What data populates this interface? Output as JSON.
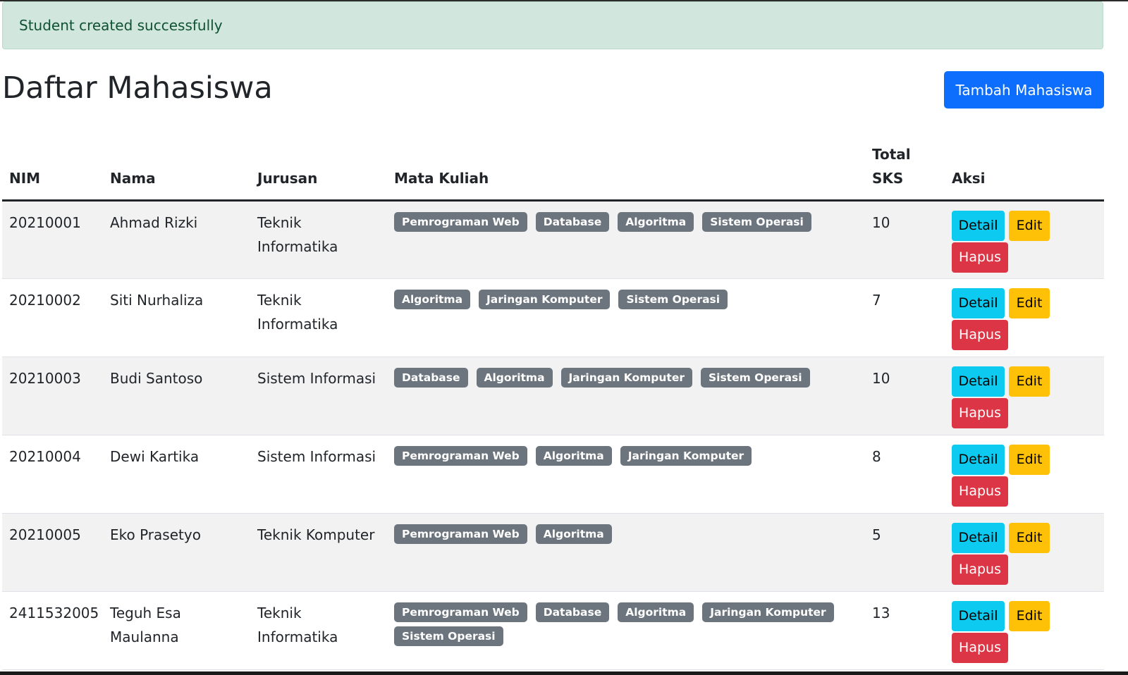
{
  "alert": {
    "message": "Student created successfully"
  },
  "header": {
    "title": "Daftar Mahasiswa",
    "add_button_label": "Tambah Mahasiswa"
  },
  "table": {
    "headers": {
      "nim": "NIM",
      "nama": "Nama",
      "jurusan": "Jurusan",
      "mata_kuliah": "Mata Kuliah",
      "total_sks_line1": "Total",
      "total_sks_line2": "SKS",
      "aksi": "Aksi"
    },
    "action_labels": {
      "detail": "Detail",
      "edit": "Edit",
      "hapus": "Hapus"
    },
    "rows": [
      {
        "nim": "20210001",
        "nama": "Ahmad Rizki",
        "jurusan": "Teknik Informatika",
        "mata_kuliah": [
          "Pemrograman Web",
          "Database",
          "Algoritma",
          "Sistem Operasi"
        ],
        "total_sks": "10"
      },
      {
        "nim": "20210002",
        "nama": "Siti Nurhaliza",
        "jurusan": "Teknik Informatika",
        "mata_kuliah": [
          "Algoritma",
          "Jaringan Komputer",
          "Sistem Operasi"
        ],
        "total_sks": "7"
      },
      {
        "nim": "20210003",
        "nama": "Budi Santoso",
        "jurusan": "Sistem Informasi",
        "mata_kuliah": [
          "Database",
          "Algoritma",
          "Jaringan Komputer",
          "Sistem Operasi"
        ],
        "total_sks": "10"
      },
      {
        "nim": "20210004",
        "nama": "Dewi Kartika",
        "jurusan": "Sistem Informasi",
        "mata_kuliah": [
          "Pemrograman Web",
          "Algoritma",
          "Jaringan Komputer"
        ],
        "total_sks": "8"
      },
      {
        "nim": "20210005",
        "nama": "Eko Prasetyo",
        "jurusan": "Teknik Komputer",
        "mata_kuliah": [
          "Pemrograman Web",
          "Algoritma"
        ],
        "total_sks": "5"
      },
      {
        "nim": "2411532005",
        "nama": "Teguh Esa Maulanna",
        "jurusan": "Teknik Informatika",
        "mata_kuliah": [
          "Pemrograman Web",
          "Database",
          "Algoritma",
          "Jaringan Komputer",
          "Sistem Operasi"
        ],
        "total_sks": "13"
      }
    ]
  }
}
